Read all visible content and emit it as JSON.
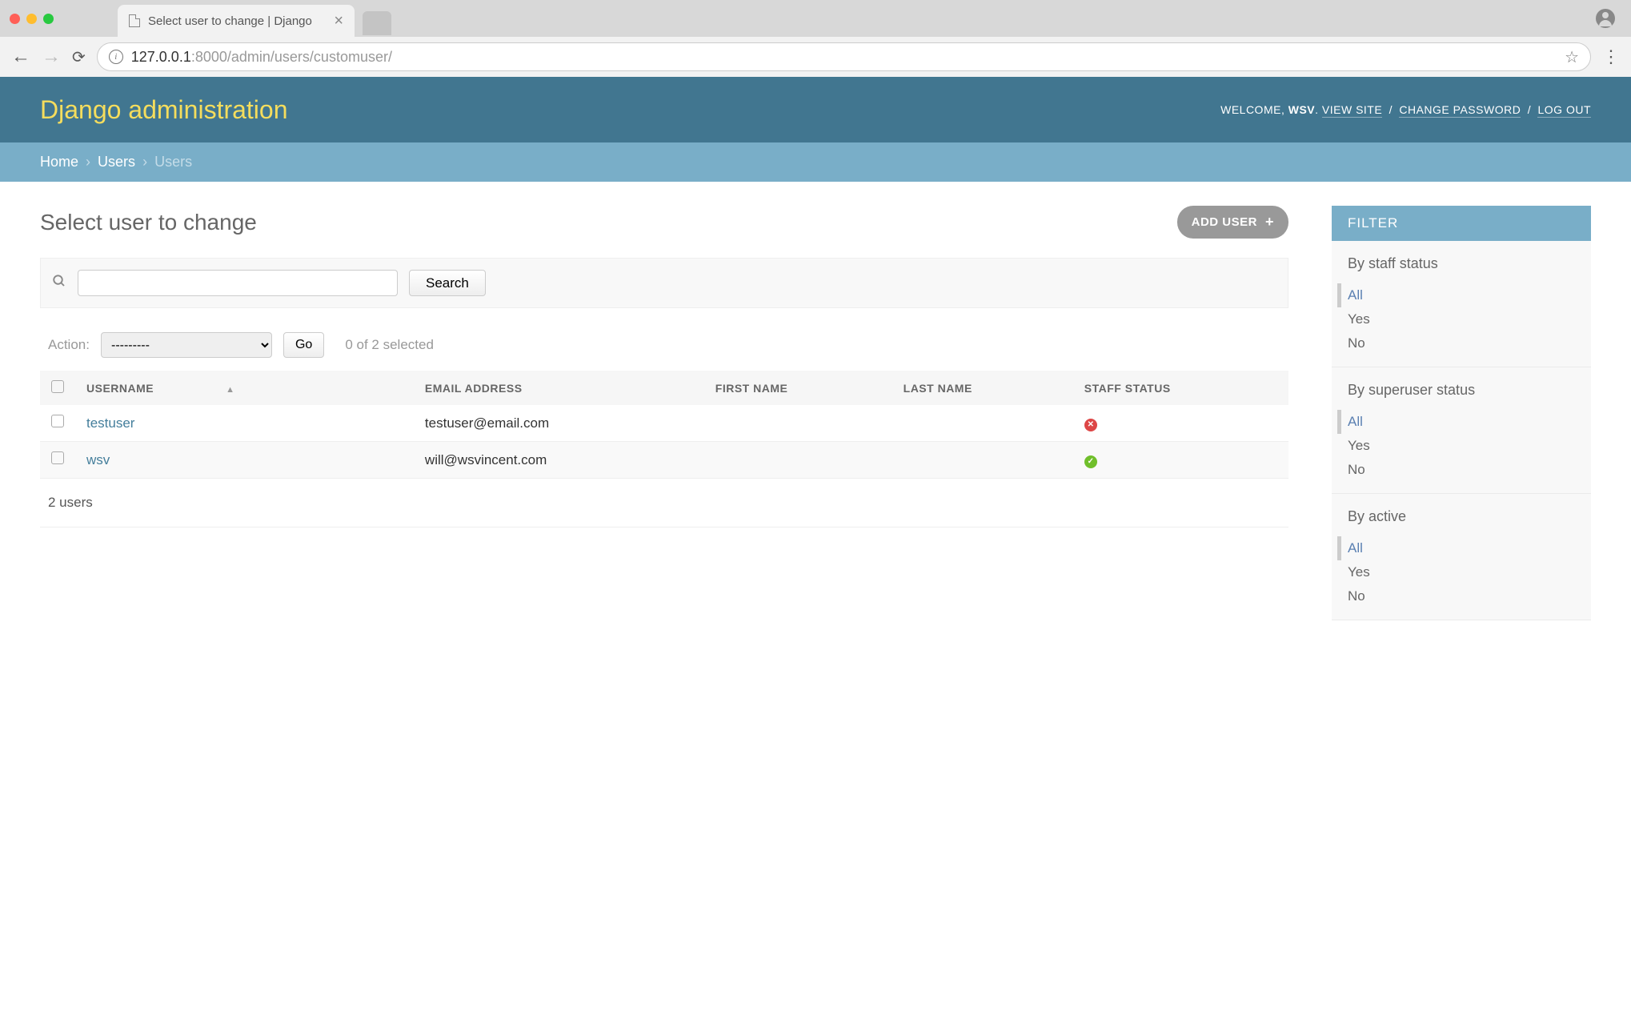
{
  "browser": {
    "tab_title": "Select user to change | Django",
    "url_prefix": "127.0.0.1",
    "url_suffix": ":8000/admin/users/customuser/"
  },
  "header": {
    "site_title": "Django administration",
    "welcome": "WELCOME, ",
    "username": "WSV",
    "view_site": "VIEW SITE",
    "change_password": "CHANGE PASSWORD",
    "logout": "LOG OUT"
  },
  "breadcrumbs": {
    "home": "Home",
    "users_app": "Users",
    "users_model": "Users"
  },
  "page": {
    "title": "Select user to change",
    "add_button": "ADD USER",
    "search_button": "Search",
    "action_label": "Action:",
    "action_placeholder": "---------",
    "go_button": "Go",
    "selection_count": "0 of 2 selected",
    "summary": "2 users"
  },
  "columns": {
    "username": "USERNAME",
    "email": "EMAIL ADDRESS",
    "first_name": "FIRST NAME",
    "last_name": "LAST NAME",
    "staff_status": "STAFF STATUS"
  },
  "rows": [
    {
      "username": "testuser",
      "email": "testuser@email.com",
      "first_name": "",
      "last_name": "",
      "staff": false
    },
    {
      "username": "wsv",
      "email": "will@wsvincent.com",
      "first_name": "",
      "last_name": "",
      "staff": true
    }
  ],
  "filter": {
    "title": "FILTER",
    "groups": [
      {
        "title": "By staff status",
        "options": [
          "All",
          "Yes",
          "No"
        ],
        "selected": "All"
      },
      {
        "title": "By superuser status",
        "options": [
          "All",
          "Yes",
          "No"
        ],
        "selected": "All"
      },
      {
        "title": "By active",
        "options": [
          "All",
          "Yes",
          "No"
        ],
        "selected": "All"
      }
    ]
  }
}
